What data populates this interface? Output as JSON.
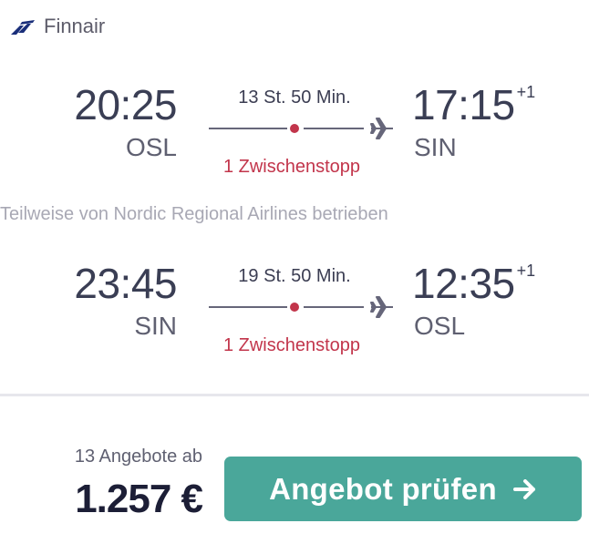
{
  "airline": {
    "name": "Finnair",
    "logo": "finnair-logo"
  },
  "colors": {
    "accent": "#4aa79a",
    "stops": "#c2354b",
    "text_dark": "#3a3e54",
    "price": "#1c1e36"
  },
  "outbound": {
    "depart_time": "20:25",
    "depart_code": "OSL",
    "duration": "13 St. 50 Min.",
    "stops": "1 Zwischenstopp",
    "arrive_time": "17:15",
    "arrive_day_offset": "+1",
    "arrive_code": "SIN"
  },
  "operated_by": "Teilweise von Nordic Regional Airlines betrieben",
  "return": {
    "depart_time": "23:45",
    "depart_code": "SIN",
    "duration": "19 St. 50 Min.",
    "stops": "1 Zwischenstopp",
    "arrive_time": "12:35",
    "arrive_day_offset": "+1",
    "arrive_code": "OSL"
  },
  "footer": {
    "offers_label": "13 Angebote ab",
    "price": "1.257 €",
    "cta_label": "Angebot prüfen",
    "cta_icon": "arrow-right-icon"
  }
}
